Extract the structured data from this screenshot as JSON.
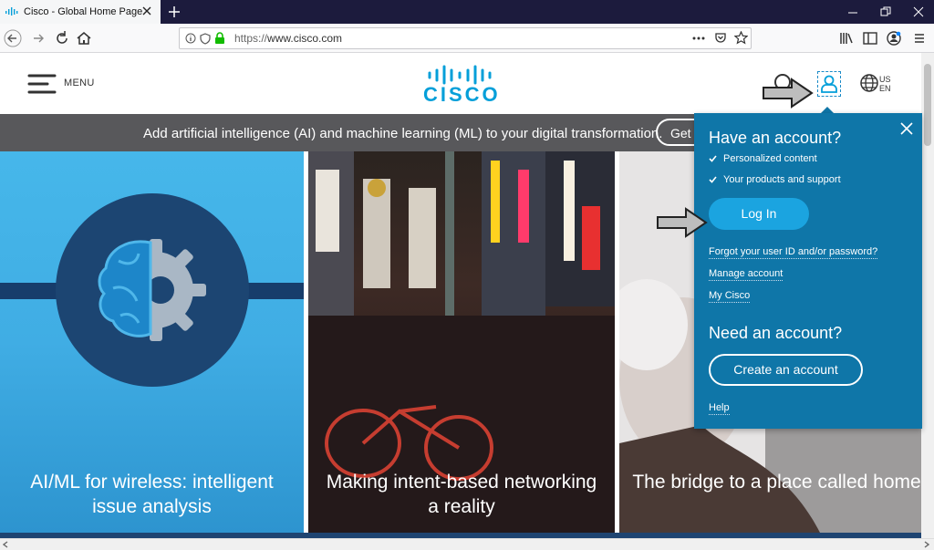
{
  "browser": {
    "tab_title": "Cisco - Global Home Page",
    "url_scheme": "https://",
    "url_host": "www.cisco.com"
  },
  "header": {
    "menu_label": "MENU",
    "logo_text": "CISCO",
    "lang_country": "US",
    "lang_code": "EN"
  },
  "banner": {
    "text": "Add artificial intelligence (AI) and machine learning (ML) to your digital transformation.",
    "button_label": "Get"
  },
  "tiles": [
    {
      "caption": "AI/ML for wireless: intelligent issue analysis"
    },
    {
      "caption": "Making intent-based networking a reality"
    },
    {
      "caption": "The bridge to a place called home"
    }
  ],
  "account_panel": {
    "heading": "Have an account?",
    "benefits": [
      "Personalized content",
      "Your products and support"
    ],
    "login_label": "Log In",
    "links": [
      "Forgot your user ID and/or password?",
      "Manage account",
      "My Cisco"
    ],
    "need_heading": "Need an account?",
    "create_label": "Create an account",
    "help_label": "Help"
  },
  "colors": {
    "cisco_blue": "#049fd9",
    "panel_blue": "#0f76a8",
    "banner_gray": "#58585b"
  }
}
